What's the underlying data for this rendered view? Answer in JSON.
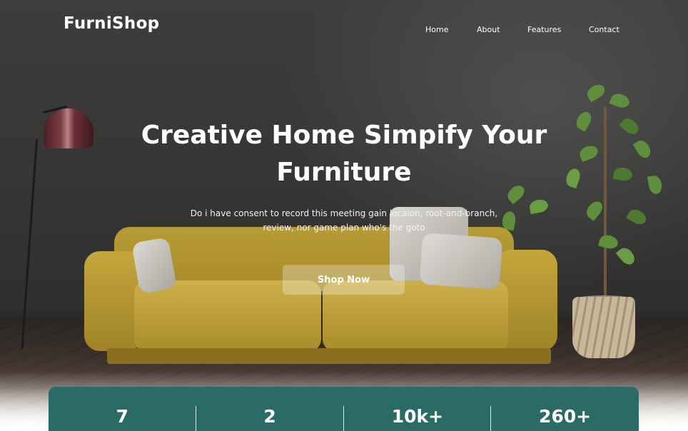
{
  "brand": {
    "name": "FurniShop"
  },
  "nav": {
    "links": [
      "Home",
      "About",
      "Features",
      "Contact"
    ]
  },
  "hero": {
    "headline_line1": "Creative Home Simpify Your",
    "headline_line2": "Furniture",
    "subtext": "Do i have consent to record this meeting gain locaion, root-and-branch, review, nor game plan who's the goto",
    "cta_label": "Shop Now"
  },
  "stats": {
    "values": [
      "7",
      "2",
      "10k+",
      "260+"
    ]
  },
  "colors": {
    "accent": "#2b6b66",
    "background": "#363634",
    "text": "#ffffff"
  }
}
